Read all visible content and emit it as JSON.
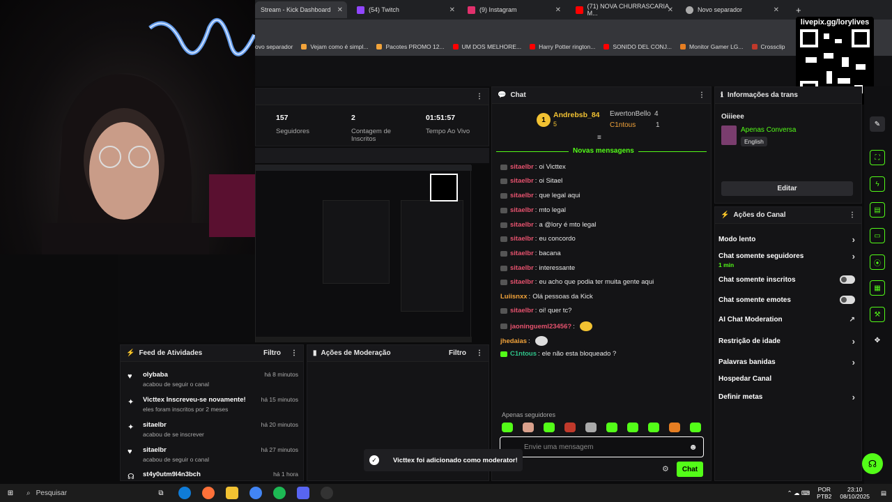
{
  "tabs": [
    {
      "label": "Stream - Kick Dashboard",
      "color": "#53fc18",
      "active": true
    },
    {
      "label": "(54) Twitch",
      "color": "#9146ff"
    },
    {
      "label": "(9) Instagram",
      "color": "#e1306c"
    },
    {
      "label": "(71) NOVA CHURRASCARIA M...",
      "color": "#ff0000"
    },
    {
      "label": "Novo separador",
      "color": "#aaa"
    }
  ],
  "bookmarks": [
    {
      "label": "ovo separador",
      "color": "#888"
    },
    {
      "label": "Vejam como é simpl...",
      "color": "#f2a33a"
    },
    {
      "label": "Pacotes PROMO 12...",
      "color": "#f2a33a"
    },
    {
      "label": "UM DOS MELHORE...",
      "color": "#ff0000"
    },
    {
      "label": "Harry Potter rington...",
      "color": "#ff0000"
    },
    {
      "label": "SONIDO DEL CONJ...",
      "color": "#ff0000"
    },
    {
      "label": "Monitor Gamer LG...",
      "color": "#e67e22"
    },
    {
      "label": "Crossclip",
      "color": "#c0392b"
    }
  ],
  "overlay": {
    "url": "livepix.gg/lorylives"
  },
  "stats": {
    "followers": "157",
    "followers_label": "Seguidores",
    "subs": "2",
    "subs_label": "Contagem de Inscritos",
    "uptime": "01:51:57",
    "uptime_label": "Tempo Ao Vivo"
  },
  "chat": {
    "title": "Chat",
    "leader1": "Andrebsb_84",
    "leader1_count": "5",
    "leader2": "EwertonBello",
    "leader2_count": "4",
    "leader3": "C1ntous",
    "leader3_count": "1",
    "new_messages": "Novas mensagens",
    "messages": [
      {
        "user": "sitaelbr",
        "text": "oi Victtex",
        "color": "pink"
      },
      {
        "user": "sitaelbr",
        "text": "oi Sitael",
        "color": "pink"
      },
      {
        "user": "sitaelbr",
        "text": "que legal aqui",
        "color": "pink"
      },
      {
        "user": "sitaelbr",
        "text": "mto legal",
        "color": "pink"
      },
      {
        "user": "sitaelbr",
        "text": "a @lory é mto legal",
        "color": "pink"
      },
      {
        "user": "sitaelbr",
        "text": "eu concordo",
        "color": "pink"
      },
      {
        "user": "sitaelbr",
        "text": "bacana",
        "color": "pink"
      },
      {
        "user": "sitaelbr",
        "text": "interessante",
        "color": "pink"
      },
      {
        "user": "sitaelbr",
        "text": "eu acho que podia ter muita gente aqui",
        "color": "pink"
      },
      {
        "user": "Luiisnxx",
        "text": "Olá pessoas da Kick",
        "color": "orange"
      },
      {
        "user": "sitaelbr",
        "text": "oi! quer tc?",
        "color": "pink"
      },
      {
        "user": "jaoningueml23456?",
        "text": "",
        "color": "pink"
      },
      {
        "user": "jhedaias",
        "text": "",
        "color": "orange"
      },
      {
        "user": "C1ntous",
        "text": "ele não esta bloqueado ?",
        "color": "teal"
      }
    ],
    "followers_only": "Apenas seguidores",
    "placeholder": "Envie uma mensagem",
    "send": "Chat"
  },
  "info": {
    "title": "Informações da trans",
    "stream_title": "Oiiieee",
    "category": "Apenas Conversa",
    "language": "English",
    "edit": "Editar"
  },
  "actions": {
    "title": "Ações do Canal",
    "items": [
      {
        "label": "Modo lento",
        "kind": "chev"
      },
      {
        "label": "Chat somente seguidores",
        "sub": "1 min",
        "kind": "chev"
      },
      {
        "label": "Chat somente inscritos",
        "kind": "toggle"
      },
      {
        "label": "Chat somente emotes",
        "kind": "toggle"
      },
      {
        "label": "AI Chat Moderation",
        "kind": "ext"
      },
      {
        "label": "Restrição de idade",
        "kind": "chev"
      },
      {
        "label": "Palavras banidas",
        "kind": "chev"
      },
      {
        "label": "Hospedar Canal",
        "kind": "none"
      },
      {
        "label": "Definir metas",
        "kind": "chev"
      }
    ]
  },
  "feed": {
    "title": "Feed de Atividades",
    "filter": "Filtro",
    "items": [
      {
        "name": "olybaba",
        "sub": "acabou de seguir o canal",
        "time": "há 8 minutos",
        "icon": "heart"
      },
      {
        "name": "Victtex Inscreveu-se novamente!",
        "sub": "eles foram inscritos por 2 meses",
        "time": "há 15 minutos",
        "icon": "star"
      },
      {
        "name": "sitaelbr",
        "sub": "acabou de se inscrever",
        "time": "há 20 minutos",
        "icon": "star"
      },
      {
        "name": "sitaelbr",
        "sub": "acabou de seguir o canal",
        "time": "há 27 minutos",
        "icon": "heart"
      },
      {
        "name": "st4y0utm9l4n3bch",
        "sub": "",
        "time": "há 1 hora",
        "icon": "headphones"
      }
    ]
  },
  "moderation": {
    "title": "Ações de Moderação",
    "filter": "Filtro"
  },
  "toast": {
    "text": "Victtex foi adicionado como moderator!"
  },
  "taskbar": {
    "search": "Pesquisar",
    "lang1": "POR",
    "lang2": "PTB2",
    "time": "23:10",
    "date": "08/10/2025"
  }
}
